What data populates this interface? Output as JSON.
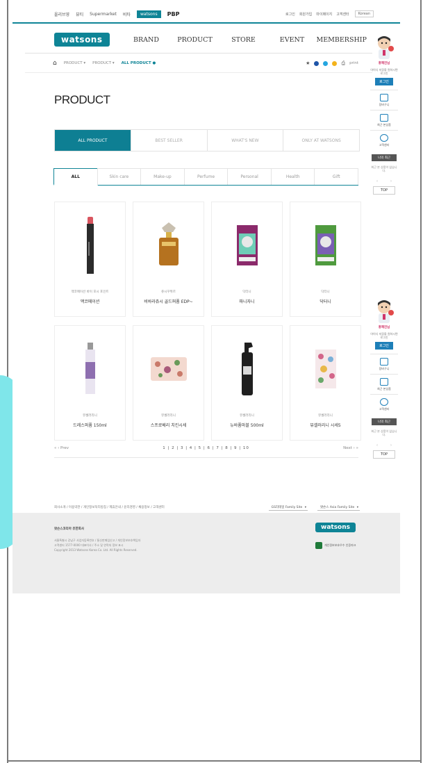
{
  "utility": {
    "family_sites": [
      "올리브영",
      "뷰티",
      "Supermarket",
      "비타",
      "watsons",
      "PBP"
    ],
    "active_index": 4,
    "links": [
      "로그인",
      "회원가입",
      "마이페이지",
      "고객센터"
    ],
    "lang": "Korean"
  },
  "logo": "watsons",
  "gnb": [
    "BRAND",
    "PRODUCT",
    "STORE",
    "EVENT",
    "MEMBERSHIP"
  ],
  "breadcrumb": {
    "items": [
      "PRODUCT",
      "PRODUCT",
      "ALL PRODUCT"
    ],
    "print_label": "print"
  },
  "page_title": "PRODUCT",
  "main_tabs": [
    "ALL PRODUCT",
    "BEST SELLER",
    "WHAT'S NEW",
    "ONLY AT WATSONS"
  ],
  "category_tabs": [
    "ALL",
    "Skin care",
    "Make-up",
    "Perfume",
    "Personal",
    "Health",
    "Gift"
  ],
  "products": [
    {
      "brand": "맥코메이션 바이 포시 포인트",
      "name": "맥코메이션",
      "icon": "lipstick-product-image",
      "color": "#2b2b2b"
    },
    {
      "brand": "쥬시꾸뛰르",
      "name": "비바라쥬시 골드퍼퓸 EDP~",
      "icon": "perfume-bottle-product-image",
      "color": "#b5721f"
    },
    {
      "brand": "닥터니",
      "name": "파니자니",
      "icon": "mask-pack-product-image",
      "color": "#8b2a6b"
    },
    {
      "brand": "닥터니",
      "name": "닥터니",
      "icon": "mask-pack-product-image",
      "color": "#4f9a3e"
    },
    {
      "brand": "뷰셀러리니",
      "name": "드레스퍼퓸 150ml",
      "icon": "spray-product-image",
      "color": "#8e6fb0"
    },
    {
      "brand": "뷰셀러리니",
      "name": "스프로베리 치킨시세",
      "icon": "floral-pouch-product-image",
      "color": "#c97a6a"
    },
    {
      "brand": "뷰셀러리니",
      "name": "뉴바퓸마블 500ml",
      "icon": "black-spray-product-image",
      "color": "#1f1f1f"
    },
    {
      "brand": "뷰셀러리니",
      "name": "뷰셀러리니 시세5",
      "icon": "pattern-mask-product-image",
      "color": "#d3668a"
    }
  ],
  "pager": {
    "prev": "« ‹ Prev",
    "pages": "1 | 2 | 3 | 4 | 5 | 6 | 7 | 8 | 9 | 10",
    "next": "Next › »"
  },
  "footer": {
    "links": "회사소개 / 이용약관 / 개인정보처리방침 / 제휴안내 / 윤리경영 / 채용정보 / 고객센터",
    "family_site": "GS리테일 Family Site",
    "asia_site": "왓슨스 Asia Family Site",
    "corp": "왓슨스코리아 유한회사",
    "info1": "서울특별시 강남구 사업자등록번호 / 통신판매업신고 / 개인정보보호책임자",
    "info2": "고객센터 1577-0000 대표이사 / 주소 및 연락처 정보 표시",
    "copyright": "Copyright 2013 Watsons Korea Co. Ltd. All Rights Reserved.",
    "logo": "watsons",
    "cert": "개인정보보호우수 인증마크"
  },
  "quick": {
    "nick": "홍혜진님",
    "desc": "아이디 저장을 원하시면 로그인",
    "login": "로그인",
    "items": [
      "장바구니",
      "최근 본상품",
      "고객센터"
    ],
    "recent": "나의 최근",
    "none": "최근 본 상품이 없습니다.",
    "top": "TOP"
  }
}
